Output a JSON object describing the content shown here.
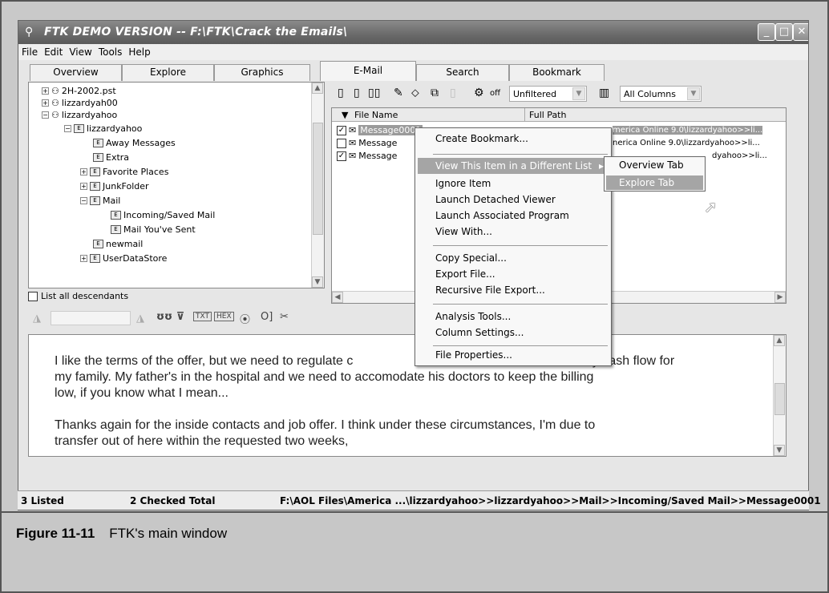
{
  "window": {
    "title": "FTK DEMO VERSION -- F:\\FTK\\Crack the Emails\\",
    "min": "_",
    "max": "□",
    "close": "✕"
  },
  "menu": [
    "File",
    "Edit",
    "View",
    "Tools",
    "Help"
  ],
  "tabs": [
    "Overview",
    "Explore",
    "Graphics",
    "E-Mail",
    "Search",
    "Bookmark"
  ],
  "tree": {
    "items": [
      {
        "label": "2H-2002.pst",
        "badge": "",
        "toggle": "+"
      },
      {
        "label": "lizzardyah00",
        "badge": "",
        "toggle": "+"
      },
      {
        "label": "lizzardyahoo",
        "badge": "",
        "toggle": "−"
      },
      {
        "label": "lizzardyahoo",
        "badge": "E",
        "toggle": "−"
      },
      {
        "label": "Away Messages",
        "badge": "E",
        "toggle": ""
      },
      {
        "label": "Extra",
        "badge": "E",
        "toggle": ""
      },
      {
        "label": "Favorite Places",
        "badge": "E",
        "toggle": "+"
      },
      {
        "label": "JunkFolder",
        "badge": "E",
        "toggle": "+"
      },
      {
        "label": "Mail",
        "badge": "E",
        "toggle": "−"
      },
      {
        "label": "Incoming/Saved Mail",
        "badge": "E",
        "toggle": ""
      },
      {
        "label": "Mail You've Sent",
        "badge": "E",
        "toggle": ""
      },
      {
        "label": "newmail",
        "badge": "E",
        "toggle": ""
      },
      {
        "label": "UserDataStore",
        "badge": "E",
        "toggle": "+"
      }
    ],
    "list_all": "List all descendants"
  },
  "toolbar": {
    "off_label": "off",
    "filter_value": "Unfiltered",
    "columns_value": "All Columns"
  },
  "list": {
    "col_file": "File Name",
    "col_path": "Full Path",
    "rows": [
      {
        "name": "Message0001",
        "path": "merica Online 9.0\\lizzardyahoo>>li...",
        "checked": "✓"
      },
      {
        "name": "Message",
        "path": "nerica Online 9.0\\lizzardyahoo>>li...",
        "checked": ""
      },
      {
        "name": "Message",
        "path": "dyahoo>>li...",
        "checked": "✓"
      }
    ]
  },
  "context_menu": {
    "items": [
      "Create Bookmark...",
      "View This Item in a Different List",
      "Ignore Item",
      "Launch Detached Viewer",
      "Launch Associated Program",
      "View With...",
      "Copy Special...",
      "Export File...",
      "Recursive File Export...",
      "Analysis Tools...",
      "Column Settings...",
      "File Properties..."
    ],
    "submenu": [
      "Overview Tab",
      "Explore Tab"
    ]
  },
  "preview": {
    "para1_a": "I like the terms of the offer, but we need to regulate c",
    "para1_b": "dy cash flow for",
    "para1_line2": "my family.  My father's in the hospital and we need to accomodate his doctors to keep the billing",
    "para1_line3": "low, if you know what I mean...",
    "para2_line1": "Thanks again for the inside contacts and job offer.  I think under these circumstances, I'm due to",
    "para2_line2": "transfer out of here within the requested two weeks,"
  },
  "status": {
    "listed": "3 Listed",
    "checked": "2 Checked Total",
    "path": "F:\\AOL Files\\America ...\\lizzardyahoo>>lizzardyahoo>>Mail>>Incoming/Saved Mail>>Message0001"
  },
  "caption": {
    "label": "Figure 11-11",
    "text": "FTK's main window"
  }
}
